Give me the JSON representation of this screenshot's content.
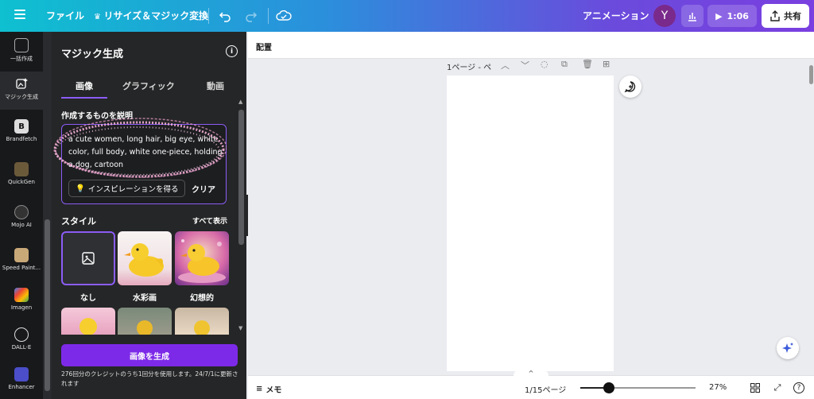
{
  "topbar": {
    "file": "ファイル",
    "resize": "リサイズ＆マジック変換",
    "animation": "アニメーション",
    "avatar_initial": "Y",
    "play_time": "1:06",
    "share": "共有"
  },
  "rail": {
    "items": [
      {
        "label": "一括作成",
        "icon": "bulk-create-icon"
      },
      {
        "label": "マジック生成",
        "icon": "magic-media-icon"
      },
      {
        "label": "Brandfetch",
        "icon": "brandfetch-icon"
      },
      {
        "label": "QuickGen",
        "icon": "quickgen-icon"
      },
      {
        "label": "Mojo AI",
        "icon": "mojo-ai-icon"
      },
      {
        "label": "Speed Paint...",
        "icon": "speed-paint-icon"
      },
      {
        "label": "Imagen",
        "icon": "imagen-icon"
      },
      {
        "label": "DALL·E",
        "icon": "dalle-icon"
      },
      {
        "label": "Enhancer",
        "icon": "enhancer-icon"
      }
    ]
  },
  "panel": {
    "title": "マジック生成",
    "tabs": [
      "画像",
      "グラフィック",
      "動画"
    ],
    "section_label": "作成するものを説明",
    "prompt": "a cute women,  long hair, big eye, white color, full body, white one-piece, holding a dog, cartoon",
    "inspire": "インスピレーションを得る",
    "clear": "クリア",
    "style_label": "スタイル",
    "show_all": "すべて表示",
    "styles": [
      "なし",
      "水彩画",
      "幻想的"
    ],
    "generate": "画像を生成",
    "credit_note": "276回分のクレジットのうち1回分を使用します。24/7/1に更新されます"
  },
  "workspace": {
    "arrange": "配置",
    "page_label": "1ページ - ペ"
  },
  "bottombar": {
    "memo": "メモ",
    "pages": "1/15ページ",
    "zoom": "27%",
    "zoom_fraction": 0.25
  },
  "colors": {
    "accent": "#8b5cf6",
    "generate": "#7d2ae8",
    "panel_bg": "#252627",
    "rail_bg": "#18191b"
  }
}
